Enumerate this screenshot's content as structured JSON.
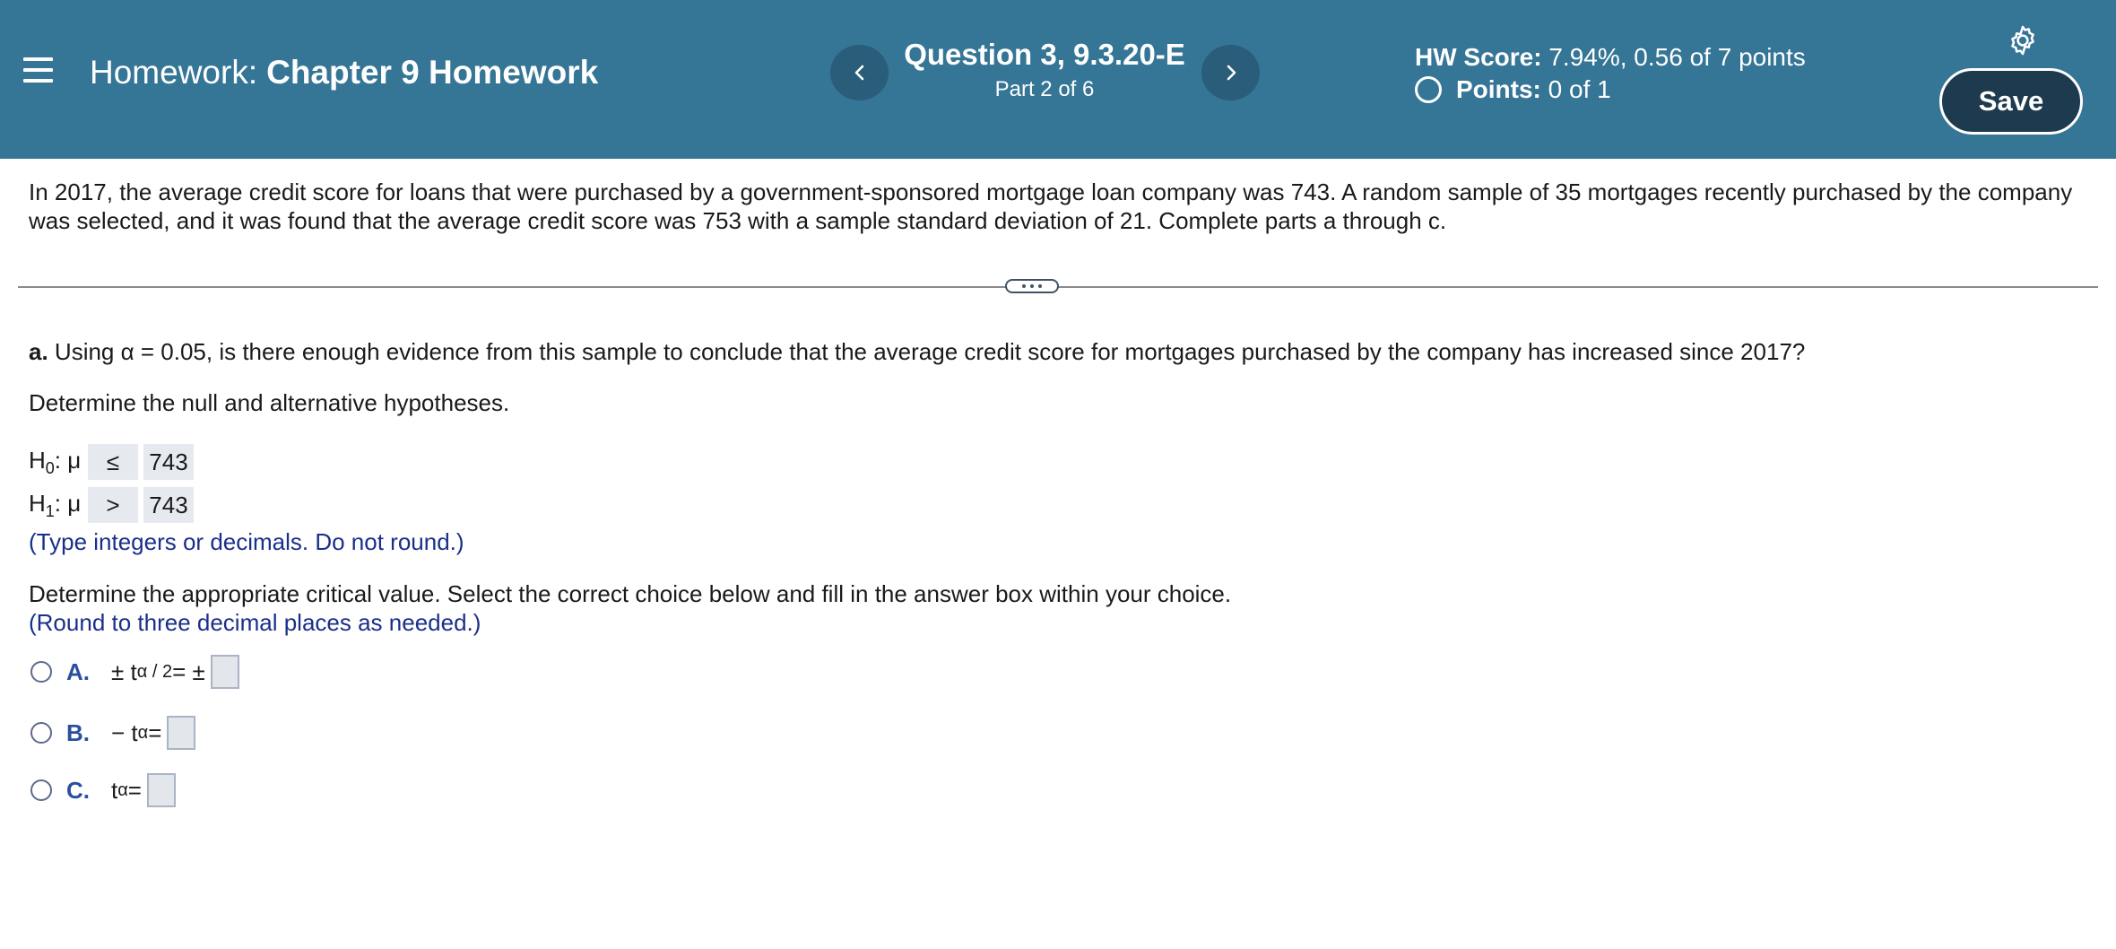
{
  "header": {
    "homework_prefix": "Homework:",
    "homework_name": "Chapter 9 Homework",
    "question_id": "Question 3, 9.3.20-E",
    "question_part": "Part 2 of 6",
    "hw_score_label": "HW Score:",
    "hw_score_value": "7.94%, 0.56 of 7 points",
    "points_label": "Points:",
    "points_value": "0 of 1",
    "save_label": "Save",
    "icons": [
      "menu-icon",
      "chevron-left-icon",
      "chevron-right-icon",
      "gear-icon",
      "circle-icon"
    ]
  },
  "problem": {
    "intro": "In 2017, the average credit score for loans that were purchased by a government-sponsored mortgage loan company was 743. A random sample of 35 mortgages recently purchased by the company was selected, and it was found that the average credit score was 753 with a sample standard deviation of 21. Complete parts a through c."
  },
  "part_a": {
    "label": "a.",
    "question": "Using α = 0.05, is there enough evidence from this sample to conclude that the average credit score for mortgages purchased by the company has increased since 2017?",
    "hypotheses_prompt": "Determine the null and alternative hypotheses.",
    "h0": {
      "label_main": "H",
      "label_sub": "0",
      "label_rest": ": μ",
      "operator": "≤",
      "value": "743"
    },
    "h1": {
      "label_main": "H",
      "label_sub": "1",
      "label_rest": ": μ",
      "operator": ">",
      "value": "743"
    },
    "hint_hypotheses": "(Type integers or decimals. Do not round.)",
    "critical_prompt": "Determine the appropriate critical value. Select the correct choice below and fill in the answer box within your choice.",
    "hint_critical": "(Round to three decimal places as needed.)",
    "choices": [
      {
        "letter": "A.",
        "prefix": "± t",
        "sub": "α / 2",
        "suffix": " = ±",
        "value": ""
      },
      {
        "letter": "B.",
        "prefix": "− t",
        "sub": "α",
        "suffix": " =",
        "value": ""
      },
      {
        "letter": "C.",
        "prefix": "t",
        "sub": "α",
        "suffix": " =",
        "value": ""
      }
    ]
  },
  "colors": {
    "header_bg": "#357595",
    "nav_button_bg": "#2a5d7a",
    "save_button_bg": "#1e3a4f",
    "hint_text": "#1a2f8a",
    "choice_letter": "#2a4ea0"
  }
}
